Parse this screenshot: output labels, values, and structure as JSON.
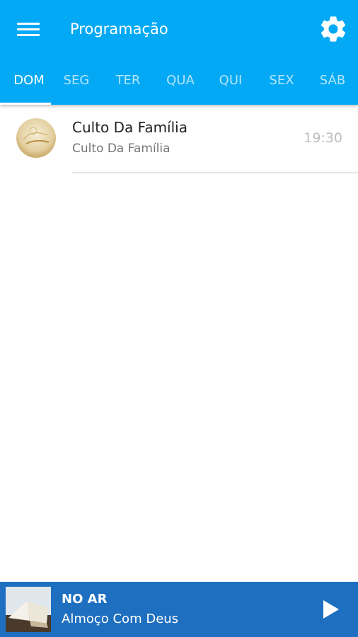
{
  "colors": {
    "appbar": "#03a9f4",
    "player": "#1e6fc0",
    "accent_text": "#ffffff"
  },
  "header": {
    "title": "Programação",
    "menu_icon": "hamburger-menu-icon",
    "settings_icon": "gear-icon"
  },
  "tabs": [
    {
      "label": "DOM",
      "active": true
    },
    {
      "label": "SEG",
      "active": false
    },
    {
      "label": "TER",
      "active": false
    },
    {
      "label": "QUA",
      "active": false
    },
    {
      "label": "QUI",
      "active": false
    },
    {
      "label": "SEX",
      "active": false
    },
    {
      "label": "SÁB",
      "active": false
    }
  ],
  "schedule": [
    {
      "title": "Culto Da Família",
      "subtitle": "Culto Da Família",
      "time": "19:30"
    }
  ],
  "player": {
    "status": "NO AR",
    "show": "Almoço Com Deus",
    "play_icon": "play-icon"
  }
}
